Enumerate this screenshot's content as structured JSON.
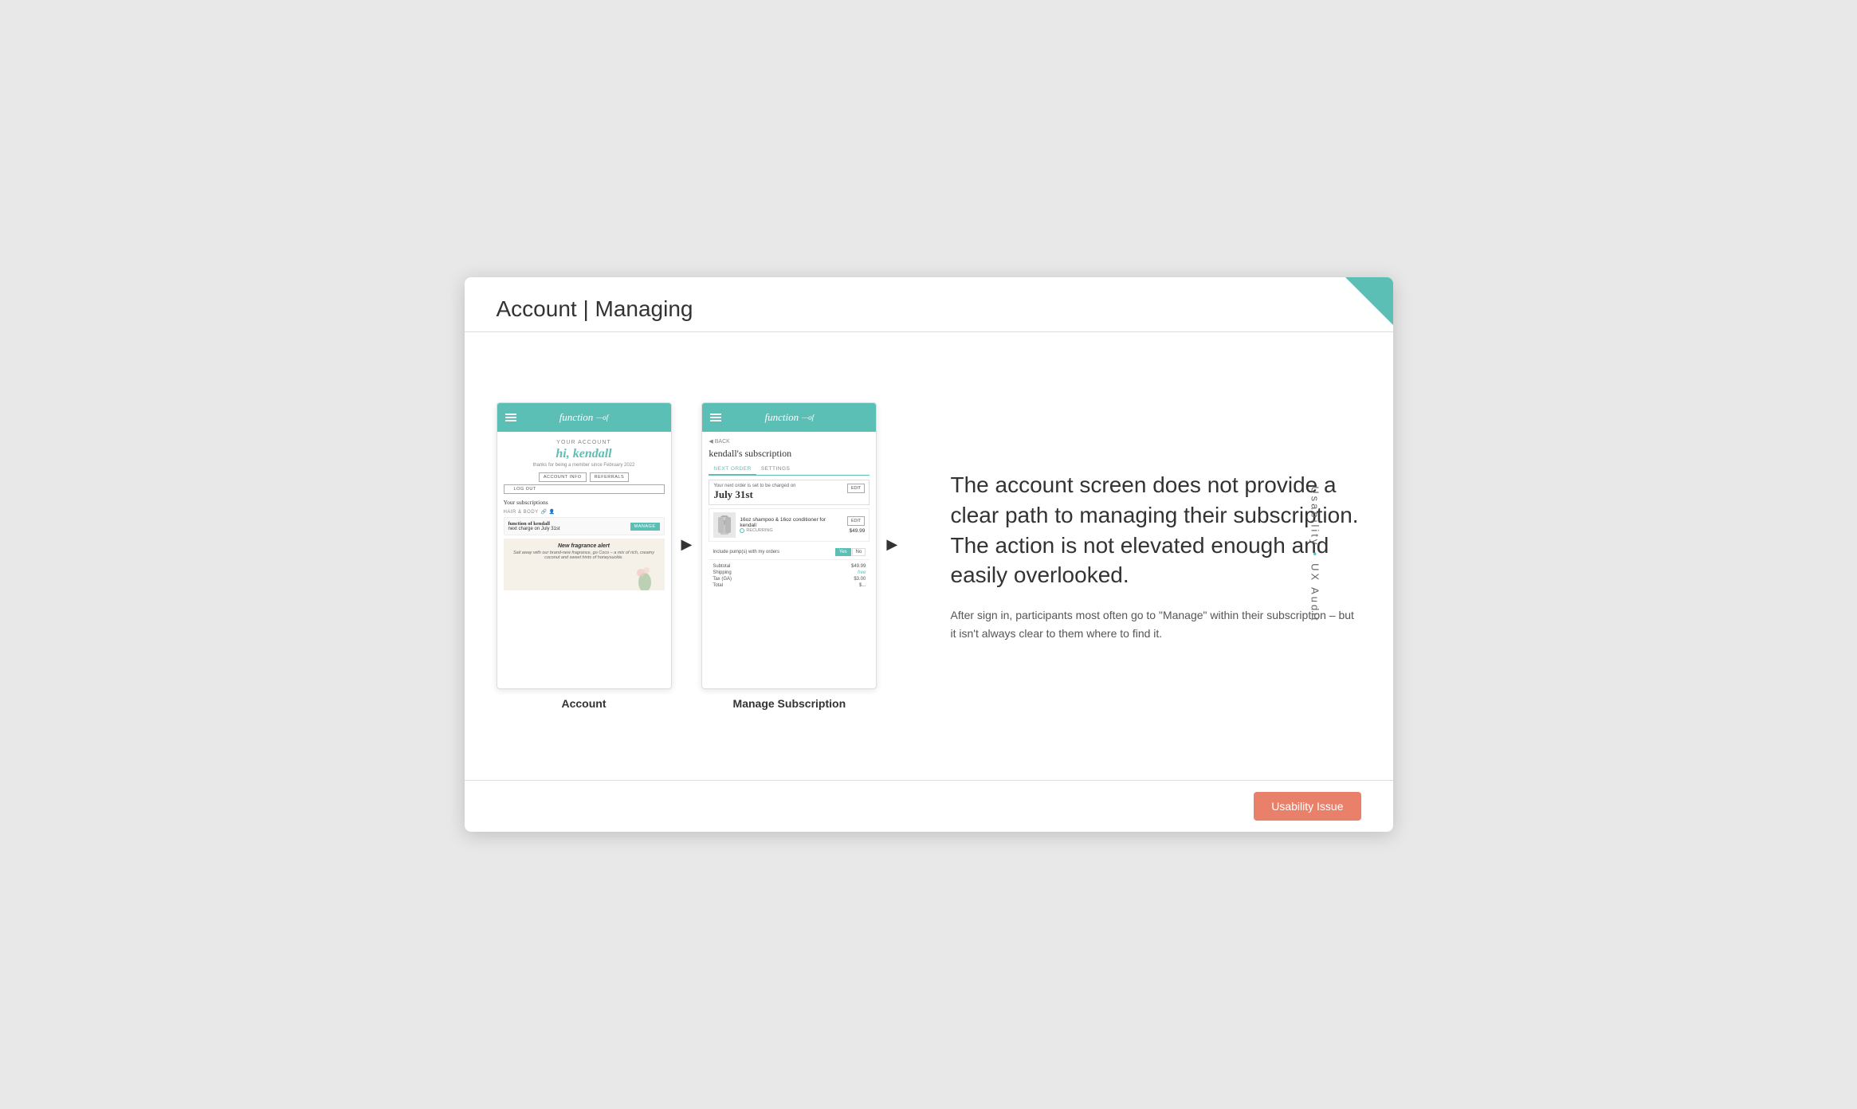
{
  "slide": {
    "title": "Account | Managing",
    "corner_color": "#5bbfb5"
  },
  "side_label": {
    "text1": "Usability",
    "dot": "•",
    "text2": "UX Audit"
  },
  "mockups": {
    "arrow": "▶",
    "screen1": {
      "label": "Account",
      "header_logo": "function",
      "greeting_label": "YOUR ACCOUNT",
      "greeting_name": "hi, kendall",
      "member_text": "thanks for being a member since February 2022",
      "btn_account": "ACCOUNT INFO",
      "btn_referrals": "REFERRALS",
      "btn_logout": "LOG OUT",
      "subscriptions_title": "Your subscriptions",
      "section_label": "HAIR & BODY",
      "sub_name": "function of kendall",
      "sub_next": "next charge on July 31st",
      "sub_manage": "MANAGE",
      "promo_title": "New fragrance alert",
      "promo_text": "Sail away with our brand-new fragrance, go Coco – a mix of rich, creamy coconut and sweet hints of honeysuckle."
    },
    "screen2": {
      "label": "Manage Subscription",
      "header_logo": "function",
      "back_label": "BACK",
      "title": "kendall's subscription",
      "tab1": "NEXT ORDER",
      "tab2": "SETTINGS",
      "order_label": "Your next order is set to be charged on",
      "order_date": "July 31st",
      "edit_btn": "EDIT",
      "product_name": "16oz shampoo & 16oz conditioner for kendall",
      "product_recurring": "RECURRING",
      "product_price": "$49.99",
      "pump_label": "Include pump(s) with my orders",
      "pump_yes": "Yes",
      "pump_no": "No",
      "subtotal_label": "Subtotal",
      "subtotal_value": "$49.99",
      "shipping_label": "Shipping",
      "shipping_value": "free",
      "tax_label": "Tax (GA)",
      "tax_value": "$3.00",
      "total_label": "Total",
      "total_value": "$..."
    }
  },
  "analysis": {
    "main_text": "The account screen does not provide a clear path to managing their subscription. The action is not elevated enough and easily overlooked.",
    "sub_text": "After sign in, participants most often go to \"Manage\" within their subscription – but it isn't always clear to them where to find it."
  },
  "footer": {
    "badge_label": "Usability Issue"
  }
}
